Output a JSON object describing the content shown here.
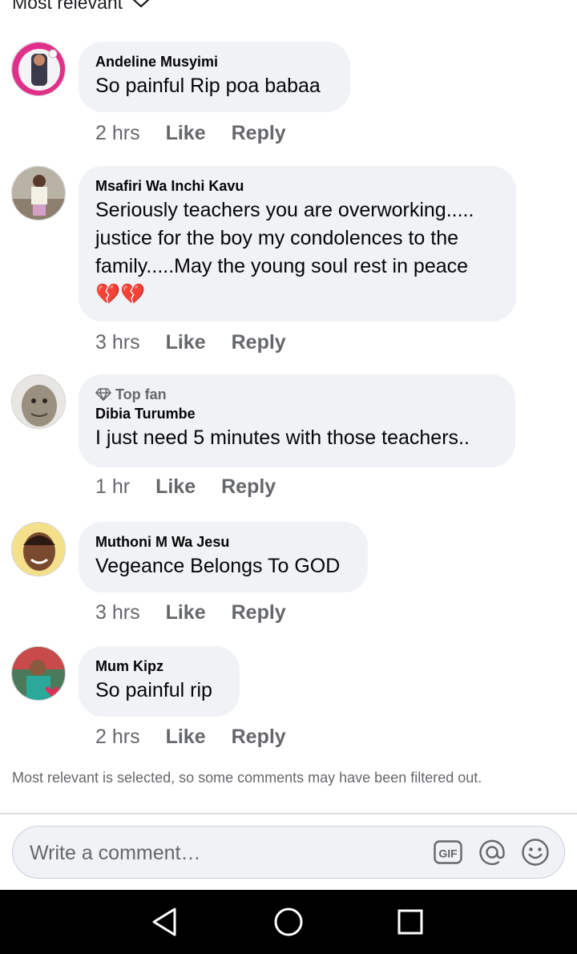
{
  "sort": {
    "label": "Most relevant"
  },
  "comments": [
    {
      "author": "Andeline Musyimi",
      "text": "So painful Rip poa babaa",
      "time": "2 hrs",
      "like": "Like",
      "reply": "Reply"
    },
    {
      "author": "Msafiri Wa Inchi Kavu",
      "text": "Seriously teachers you are overworking..... justice for the boy my condolences to the family.....May the young soul rest in peace 💔💔",
      "time": "3 hrs",
      "like": "Like",
      "reply": "Reply"
    },
    {
      "badge": "Top fan",
      "author": "Dibia Turumbe",
      "text": "I just need 5 minutes with those teachers..",
      "time": "1 hr",
      "like": "Like",
      "reply": "Reply"
    },
    {
      "author": "Muthoni M Wa Jesu",
      "text": "Vegeance Belongs To GOD",
      "time": "3 hrs",
      "like": "Like",
      "reply": "Reply"
    },
    {
      "author": "Mum Kipz",
      "text": "So painful rip",
      "time": "2 hrs",
      "like": "Like",
      "reply": "Reply"
    }
  ],
  "filter_note": "Most relevant is selected, so some comments may have been filtered out.",
  "composer": {
    "placeholder": "Write a comment…",
    "gif_label": "GIF"
  },
  "icons": {
    "sort": "chevron-down-icon",
    "badge": "diamond-icon",
    "composer": [
      "gif-icon",
      "mention-icon",
      "emoji-icon"
    ],
    "nav": [
      "back-icon",
      "home-icon",
      "recents-icon"
    ]
  },
  "colors": {
    "bubble": "#f0f2f5",
    "meta_text": "#65676b",
    "navbar": "#000000"
  }
}
